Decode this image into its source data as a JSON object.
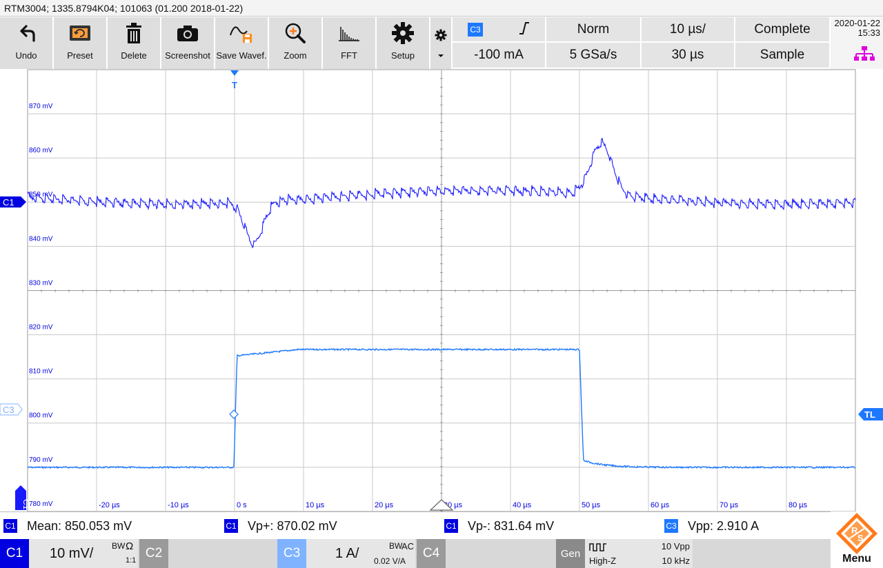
{
  "title": "RTM3004; 1335.8794K04; 101063 (01.200 2018-01-22)",
  "toolbar": {
    "undo": "Undo",
    "preset": "Preset",
    "delete": "Delete",
    "screenshot": "Screenshot",
    "save_waveform": "Save Wavef.",
    "zoom": "Zoom",
    "fft": "FFT",
    "setup": "Setup"
  },
  "trigger": {
    "source": "C3",
    "slope_symbol": "⫠",
    "mode": "Norm",
    "level": "-100 mA",
    "timebase": "10 µs/",
    "sample_rate": "5 GSa/s",
    "record": "30 µs",
    "acq_state": "Complete",
    "acq_mode": "Sample"
  },
  "clock": {
    "date": "2020-01-22",
    "time": "15:33"
  },
  "plot": {
    "markers": {
      "c1": "C1",
      "c3": "C3",
      "tl": "TL",
      "trig": "T"
    },
    "y_labels": [
      "870 mV",
      "860 mV",
      "850 mV",
      "840 mV",
      "830 mV",
      "820 mV",
      "810 mV",
      "800 mV",
      "790 mV",
      "780 mV"
    ],
    "x_labels": [
      "-20 µs",
      "-10 µs",
      "0 s",
      "10 µs",
      "20 µs",
      "30 µs",
      "40 µs",
      "50 µs",
      "60 µs",
      "70 µs",
      "80 µs"
    ],
    "colors": {
      "c1": "#1a1aff",
      "c3": "#1e78ff",
      "grid": "#c8c8c8"
    }
  },
  "measurements": [
    {
      "chip": "C1",
      "label": "Mean: 850.053 mV",
      "color": "#0000e0"
    },
    {
      "chip": "C1",
      "label": "Vp+: 870.02 mV",
      "color": "#0000e0"
    },
    {
      "chip": "C1",
      "label": "Vp-: 831.64 mV",
      "color": "#0000e0"
    },
    {
      "chip": "C3",
      "label": "Vpp: 2.910 A",
      "color": "#1e78ff"
    }
  ],
  "channels": {
    "c1": {
      "tab": "C1",
      "scale": "10 mV/",
      "bw": "BW",
      "coupling": "Ω",
      "probe": "1:1"
    },
    "c2": {
      "tab": "C2"
    },
    "c3": {
      "tab": "C3",
      "scale": "1 A/",
      "bw": "BW",
      "coupling": "AC",
      "probe": "0.02 V/A"
    },
    "c4": {
      "tab": "C4"
    },
    "gen": {
      "tab": "Gen",
      "impedance": "High-Z",
      "amplitude": "10 Vpp",
      "frequency": "10 kHz"
    }
  },
  "menu": "Menu"
}
